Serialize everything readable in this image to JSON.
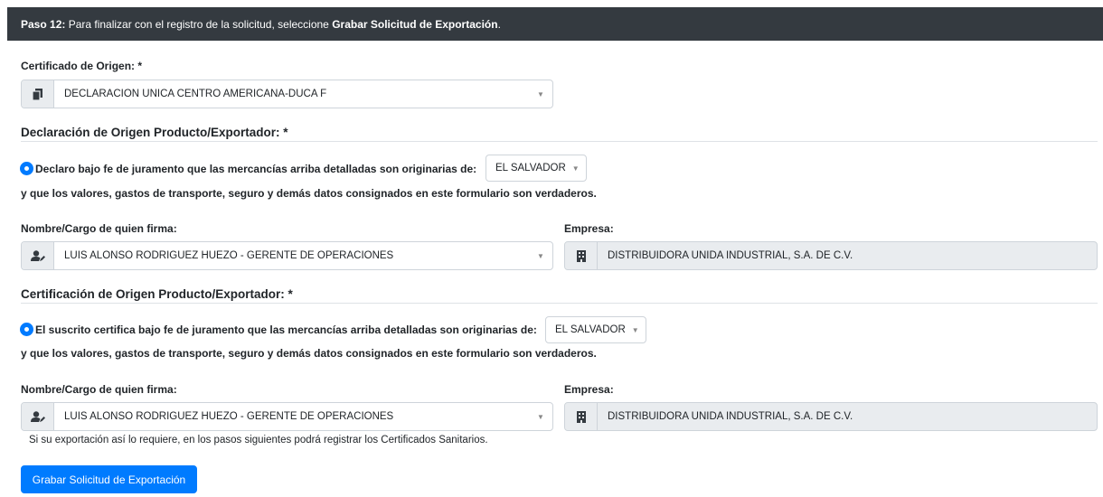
{
  "header": {
    "step_label": "Paso 12:",
    "instruction": " Para finalizar con el registro de la solicitud, seleccione ",
    "action_name": "Grabar Solicitud de Exportación",
    "period": "."
  },
  "certificado": {
    "label": "Certificado de Origen: *",
    "value": "DECLARACION UNICA CENTRO AMERICANA-DUCA F",
    "icon": "copy-icon"
  },
  "declaracion": {
    "title": "Declaración de Origen Producto/Exportador: *",
    "radio_text": "Declaro bajo fe de juramento que las mercancías arriba detalladas son originarias de:",
    "country": "EL SALVADOR",
    "continuation": "y que los valores, gastos de transporte, seguro y demás datos consignados en este formulario son verdaderos.",
    "signer_label": "Nombre/Cargo de quien firma:",
    "signer_value": "LUIS ALONSO RODRIGUEZ HUEZO - GERENTE DE OPERACIONES",
    "company_label": "Empresa:",
    "company_value": "DISTRIBUIDORA UNIDA INDUSTRIAL, S.A. DE C.V."
  },
  "certificacion": {
    "title": "Certificación de Origen Producto/Exportador: *",
    "radio_text": "El suscrito certifica bajo fe de juramento que las mercancías arriba detalladas son originarias de:",
    "country": "EL SALVADOR",
    "continuation": "y que los valores, gastos de transporte, seguro y demás datos consignados en este formulario son verdaderos.",
    "signer_label": "Nombre/Cargo de quien firma:",
    "signer_value": "LUIS ALONSO RODRIGUEZ HUEZO - GERENTE DE OPERACIONES",
    "company_label": "Empresa:",
    "company_value": "DISTRIBUIDORA UNIDA INDUSTRIAL, S.A. DE C.V."
  },
  "note": "Si su exportación así lo requiere, en los pasos siguientes podrá registrar los Certificados Sanitarios.",
  "submit_button": "Grabar Solicitud de Exportación",
  "colors": {
    "header_bg": "#343a40",
    "primary": "#007bff",
    "readonly_bg": "#e9ecef"
  }
}
